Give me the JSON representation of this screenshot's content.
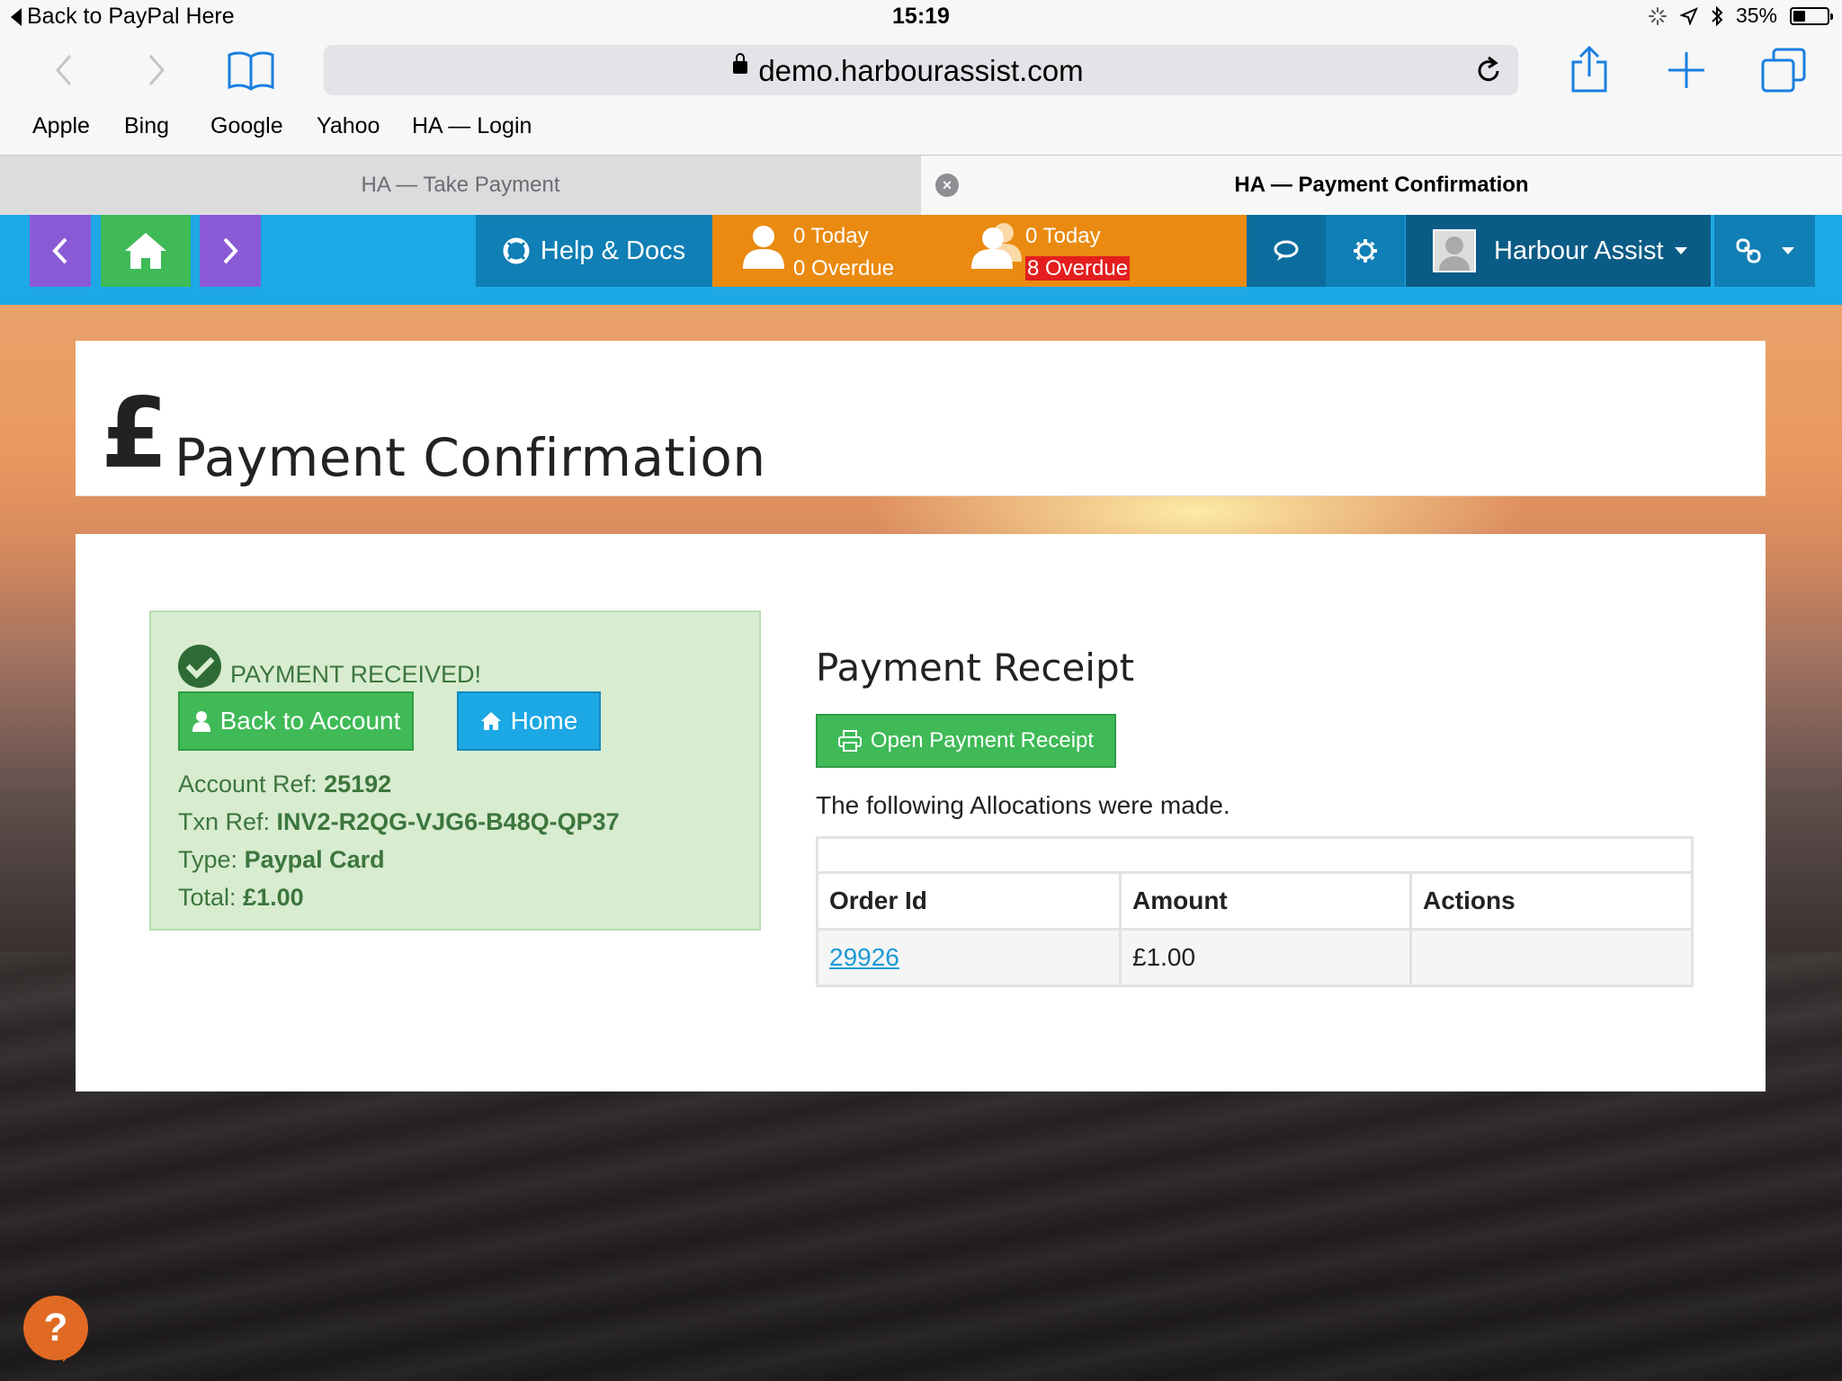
{
  "status_bar": {
    "back_label": "Back to PayPal Here",
    "time": "15:19",
    "battery": "35%",
    "battery_level": 0.35
  },
  "browser": {
    "url": "demo.harbourassist.com",
    "favorites": [
      "Apple",
      "Bing",
      "Google",
      "Yahoo",
      "HA — Login"
    ],
    "tabs": [
      {
        "title": "HA — Take Payment",
        "active": false
      },
      {
        "title": "HA — Payment Confirmation",
        "active": true
      }
    ]
  },
  "navbar": {
    "help_label": "Help & Docs",
    "counts_1": {
      "today": "0 Today",
      "overdue": "0 Overdue"
    },
    "counts_2": {
      "today": "0 Today",
      "overdue": "8 Overdue"
    },
    "user_name": "Harbour Assist"
  },
  "page": {
    "title": "Payment Confirmation",
    "currency_symbol": "£"
  },
  "payment": {
    "status": "PAYMENT RECEIVED!",
    "back_button": "Back to Account",
    "home_button": "Home",
    "account_ref_label": "Account Ref:",
    "account_ref": "25192",
    "txn_ref_label": "Txn Ref:",
    "txn_ref": "INV2-R2QG-VJG6-B48Q-QP37",
    "type_label": "Type:",
    "type": "Paypal Card",
    "total_label": "Total:",
    "total": "£1.00"
  },
  "receipt": {
    "title": "Payment Receipt",
    "open_button": "Open Payment Receipt",
    "allocations_text": "The following Allocations were made.",
    "columns": [
      "Order Id",
      "Amount",
      "Actions"
    ],
    "rows": [
      {
        "order_id": "29926",
        "amount": "£1.00",
        "actions": ""
      }
    ]
  },
  "colors": {
    "nav_blue": "#1da8e6",
    "nav_purple": "#8a5ad6",
    "nav_green": "#3fba57",
    "nav_orange": "#ea8a10",
    "overdue_red": "#e41e1e",
    "success_bg": "#d8ecd0",
    "success_text": "#3c763d"
  }
}
